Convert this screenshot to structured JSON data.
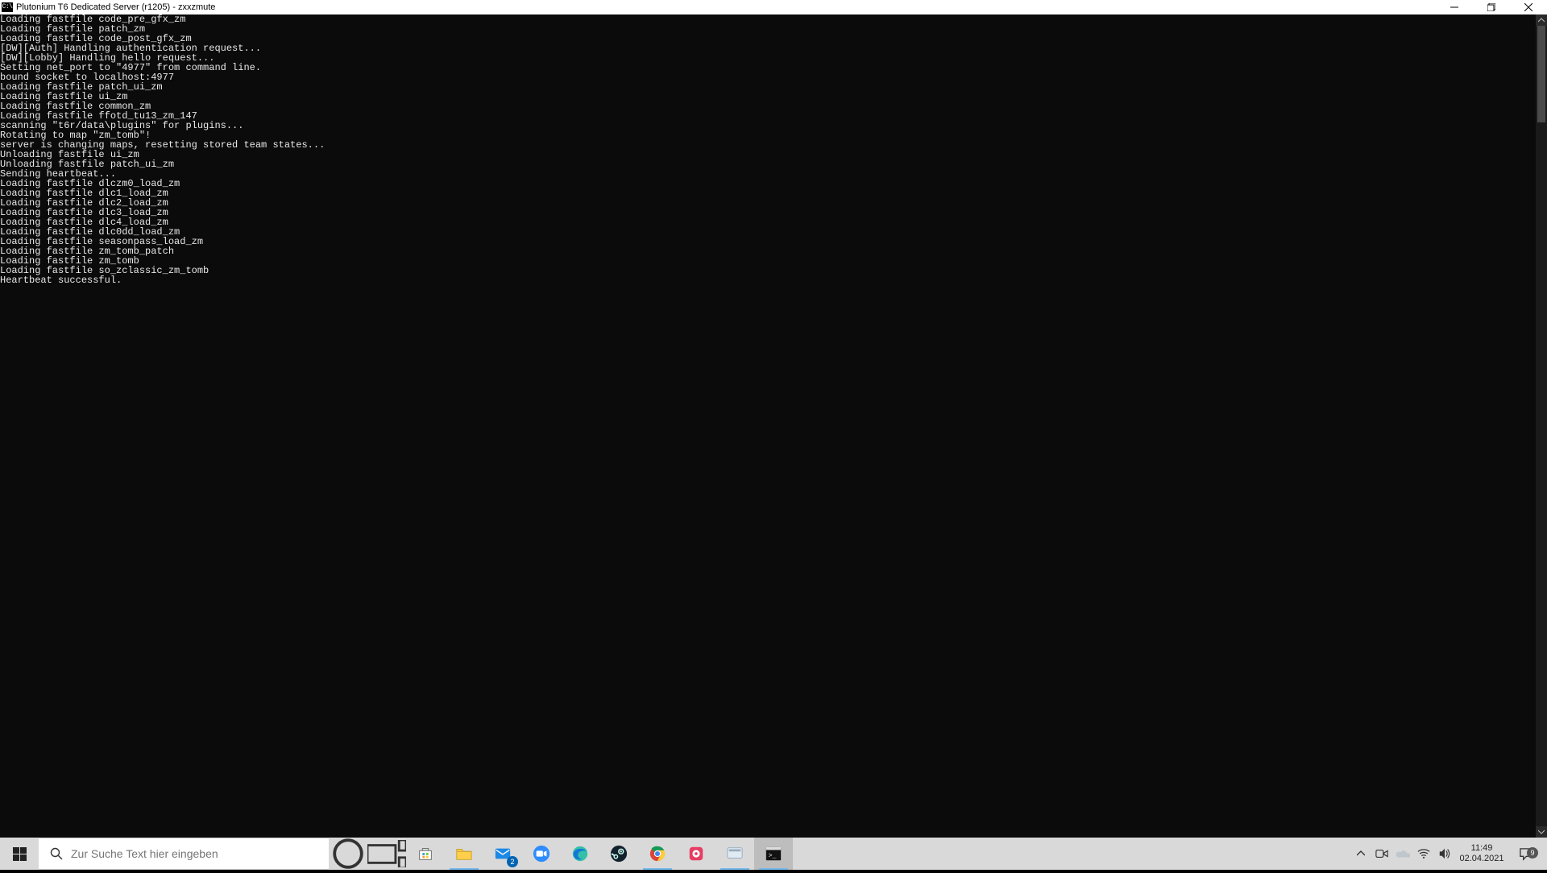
{
  "window": {
    "title": "Plutonium T6 Dedicated Server (r1205) - zxxzmute",
    "app_icon_label": "C:\\"
  },
  "console": {
    "lines": [
      "Loading fastfile code_pre_gfx_zm",
      "Loading fastfile patch_zm",
      "Loading fastfile code_post_gfx_zm",
      "[DW][Auth] Handling authentication request...",
      "[DW][Lobby] Handling hello request...",
      "Setting net_port to \"4977\" from command line.",
      "bound socket to localhost:4977",
      "Loading fastfile patch_ui_zm",
      "Loading fastfile ui_zm",
      "Loading fastfile common_zm",
      "Loading fastfile ffotd_tu13_zm_147",
      "scanning \"t6r/data\\plugins\" for plugins...",
      "Rotating to map \"zm_tomb\"!",
      "server is changing maps, resetting stored team states...",
      "Unloading fastfile ui_zm",
      "Unloading fastfile patch_ui_zm",
      "Sending heartbeat...",
      "Loading fastfile dlczm0_load_zm",
      "Loading fastfile dlc1_load_zm",
      "Loading fastfile dlc2_load_zm",
      "Loading fastfile dlc3_load_zm",
      "Loading fastfile dlc4_load_zm",
      "Loading fastfile dlc0dd_load_zm",
      "Loading fastfile seasonpass_load_zm",
      "Loading fastfile zm_tomb_patch",
      "Loading fastfile zm_tomb",
      "Loading fastfile so_zclassic_zm_tomb",
      "Heartbeat successful."
    ]
  },
  "taskbar": {
    "search_placeholder": "Zur Suche Text hier eingeben",
    "mail_badge": "2",
    "action_center_badge": "9",
    "clock_time": "11:49",
    "clock_date": "02.04.2021"
  }
}
